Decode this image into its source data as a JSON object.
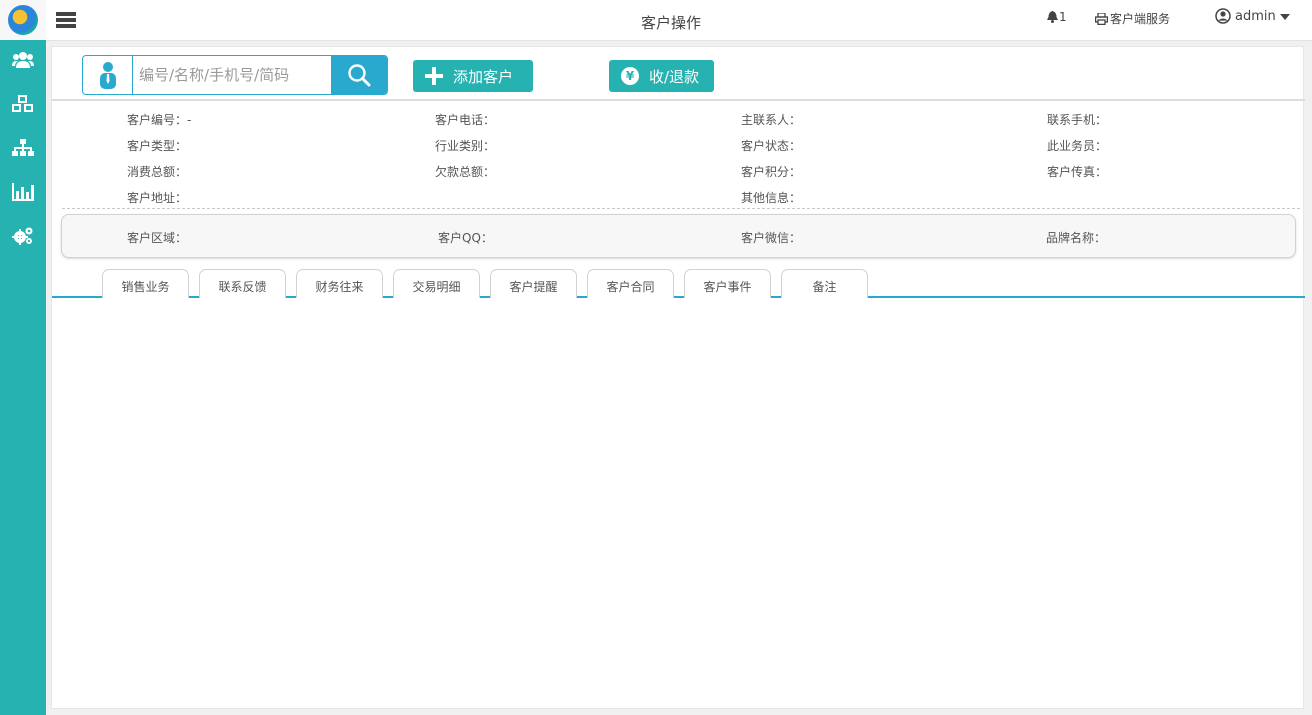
{
  "header": {
    "title": "客户操作",
    "notification_count": "1",
    "client_service_label": "客户端服务",
    "username": "admin"
  },
  "sidebar": {
    "items": [
      {
        "icon": "users-icon"
      },
      {
        "icon": "cubes-icon"
      },
      {
        "icon": "sitemap-icon"
      },
      {
        "icon": "bar-chart-icon"
      },
      {
        "icon": "gears-icon"
      }
    ]
  },
  "toolbar": {
    "search_placeholder": "编号/名称/手机号/简码",
    "search_value": "",
    "add_customer_label": "添加客户",
    "payment_label": "收/退款",
    "payment_symbol": "¥"
  },
  "customer_info": {
    "row1": [
      "客户编号：-",
      "客户电话：",
      "主联系人：",
      "联系手机："
    ],
    "row2": [
      "客户类型：",
      "行业类别：",
      "客户状态：",
      "此业务员："
    ],
    "row3": [
      "消费总额：",
      "欠款总额：",
      "客户积分：",
      "客户传真："
    ],
    "row4": [
      "客户地址：",
      "其他信息："
    ]
  },
  "extra_info": [
    "客户区域：",
    "客户QQ：",
    "客户微信：",
    "品牌名称："
  ],
  "tabs": [
    "销售业务",
    "联系反馈",
    "财务往来",
    "交易明细",
    "客户提醒",
    "客户合同",
    "客户事件",
    "备注"
  ],
  "colors": {
    "sidebar": "#27b2b2",
    "accent_blue": "#2aa9cf",
    "button_teal": "#27b2b2"
  }
}
